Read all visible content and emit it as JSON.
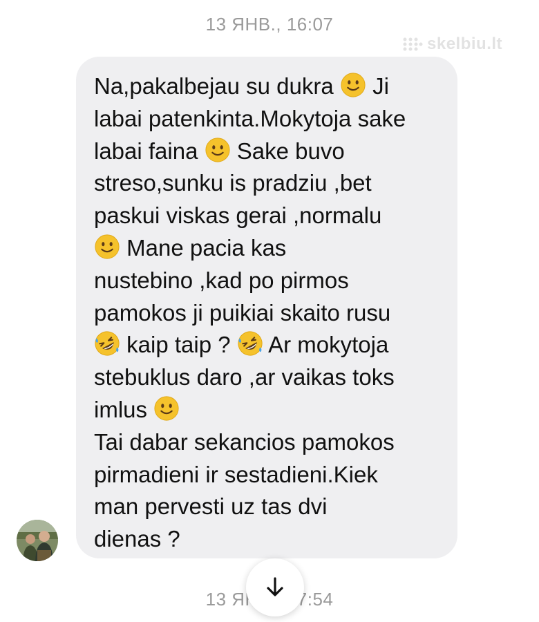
{
  "header": {
    "timestamp": "13 ЯНВ., 16:07"
  },
  "watermark": {
    "text": "skelbiu.lt"
  },
  "message": {
    "lines": [
      [
        {
          "t": "Na,pakalbejau su dukra "
        },
        {
          "e": "slight-smile"
        },
        {
          "t": " Ji"
        }
      ],
      [
        {
          "t": "labai patenkinta.Mokytoja sake"
        }
      ],
      [
        {
          "t": "labai faina "
        },
        {
          "e": "slight-smile"
        },
        {
          "t": " Sake buvo"
        }
      ],
      [
        {
          "t": "streso,sunku is pradziu ,bet"
        }
      ],
      [
        {
          "t": "paskui viskas gerai ,normalu"
        }
      ],
      [
        {
          "e": "slight-smile"
        },
        {
          "t": " Mane pacia kas"
        }
      ],
      [
        {
          "t": "nustebino ,kad po pirmos"
        }
      ],
      [
        {
          "t": "pamokos ji puikiai skaito rusu"
        }
      ],
      [
        {
          "e": "rofl"
        },
        {
          "t": " kaip taip ? "
        },
        {
          "e": "rofl"
        },
        {
          "t": " Ar mokytoja"
        }
      ],
      [
        {
          "t": "stebuklus daro ,ar vaikas toks"
        }
      ],
      [
        {
          "t": "imlus "
        },
        {
          "e": "slight-smile"
        }
      ],
      [
        {
          "t": "Tai dabar sekancios pamokos"
        }
      ],
      [
        {
          "t": "pirmadieni ir sestadieni.Kiek"
        }
      ],
      [
        {
          "t": "man pervesti uz tas dvi"
        }
      ],
      [
        {
          "t": "dienas ?"
        }
      ]
    ]
  },
  "footer": {
    "timestamp": "13 ЯНВ., 17:54"
  },
  "icons": {
    "scroll_down": "arrow-down-icon",
    "emoji_smile": "slightly-smiling-face-icon",
    "emoji_rofl": "rolling-on-floor-laughing-icon"
  },
  "colors": {
    "bubble": "#efeff1",
    "timestamp": "#9a9a9a",
    "text": "#111111",
    "emoji_face": "#f5c22c"
  }
}
